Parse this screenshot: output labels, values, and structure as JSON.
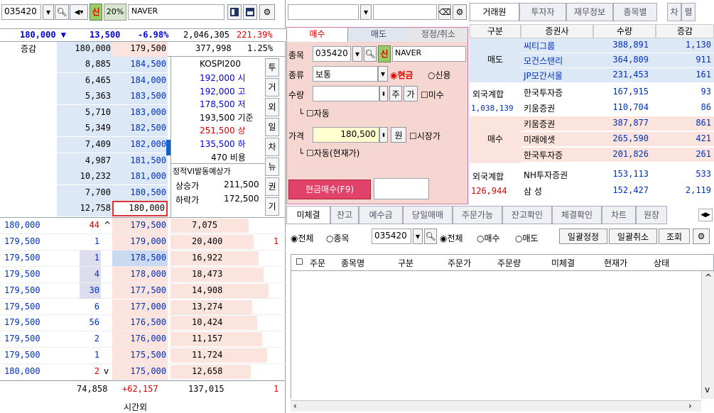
{
  "left": {
    "code": "035420",
    "sin": "신",
    "margin": "20%",
    "name": "NAVER",
    "price": "180,000 ▼",
    "change": "13,500",
    "rate": "-6.98%",
    "volume": "2,046,305",
    "vrate": "221.39%",
    "hdr": {
      "label": "증감",
      "v1": "180,000",
      "v2": "179,500",
      "v3": "377,998",
      "v4": "1.25%"
    },
    "asks": [
      {
        "q": "8,885",
        "p": "184,500"
      },
      {
        "q": "6,465",
        "p": "184,000"
      },
      {
        "q": "5,363",
        "p": "183,500"
      },
      {
        "q": "5,710",
        "p": "183,000"
      },
      {
        "q": "5,349",
        "p": "182,500"
      },
      {
        "q": "7,409",
        "p": "182,000"
      },
      {
        "q": "4,987",
        "p": "181,500"
      },
      {
        "q": "10,232",
        "p": "181,000"
      },
      {
        "q": "7,700",
        "p": "180,500"
      },
      {
        "q": "12,758",
        "p": "180,000"
      }
    ],
    "info": {
      "kospi": "KOSPI200",
      "si": "192,000 시",
      "go": "192,000 고",
      "jeo": "178,500 저",
      "gijun": "193,500 기준",
      "sang": "251,500 상",
      "ha": "135,500 하",
      "biyong": "470 비용",
      "vi": "정적VI발동예상가",
      "sangsung": "상승가",
      "sangsung_v": "211,500",
      "harak": "하락가",
      "harak_v": "172,500"
    },
    "sidebtns": [
      "투",
      "거",
      "외",
      "일",
      "차",
      "뉴",
      "권",
      "기"
    ],
    "bids": [
      {
        "t": "180,000",
        "q": "44",
        "ar": "^",
        "p": "179,500",
        "bq": "7,075",
        "x": ""
      },
      {
        "t": "179,500",
        "q": "1",
        "ar": "",
        "p": "179,000",
        "bq": "20,400",
        "x": "1"
      },
      {
        "t": "179,500",
        "q": "1",
        "ar": "",
        "p": "178,500",
        "bq": "16,922",
        "x": ""
      },
      {
        "t": "179,500",
        "q": "4",
        "ar": "",
        "p": "178,000",
        "bq": "18,473",
        "x": ""
      },
      {
        "t": "179,500",
        "q": "30",
        "ar": "",
        "p": "177,500",
        "bq": "14,908",
        "x": ""
      },
      {
        "t": "179,500",
        "q": "6",
        "ar": "",
        "p": "177,000",
        "bq": "13,274",
        "x": ""
      },
      {
        "t": "179,500",
        "q": "56",
        "ar": "",
        "p": "176,500",
        "bq": "10,424",
        "x": ""
      },
      {
        "t": "179,500",
        "q": "2",
        "ar": "",
        "p": "176,000",
        "bq": "11,157",
        "x": ""
      },
      {
        "t": "179,500",
        "q": "1",
        "ar": "",
        "p": "175,500",
        "bq": "11,724",
        "x": ""
      },
      {
        "t": "180,000",
        "q": "2",
        "ar": "v",
        "p": "175,000",
        "bq": "12,658",
        "x": ""
      }
    ],
    "foot": {
      "a": "74,858",
      "b": "+62,157",
      "c": "137,015",
      "d": "1",
      "e": "시간외"
    }
  },
  "mid": {
    "tabs": [
      "매수",
      "매도",
      "정정/취소"
    ],
    "jongmok": "종목",
    "code": "035420",
    "sin": "신",
    "name": "NAVER",
    "jongryu": "종류",
    "jongryu_v": "보통",
    "cash": "현금",
    "credit": "신용",
    "suryang": "수량",
    "ju": "주",
    "ga": "가",
    "misu": "미수",
    "auto": "자동",
    "gagyeok": "가격",
    "price": "180,500",
    "won": "원",
    "market": "시장가",
    "auto2": "자동(현재가)",
    "submit": "현금매수(F9)"
  },
  "right": {
    "tabs": [
      "거래원",
      "투자자",
      "재무정보",
      "종목별",
      "차",
      "펼"
    ],
    "cols": [
      "구분",
      "증권사",
      "수량",
      "증감"
    ],
    "sell_label": "매도",
    "buy_label": "매수",
    "sell": [
      {
        "f": "씨티그룹",
        "q": "388,891",
        "d": "1,130"
      },
      {
        "f": "모건스탠리",
        "q": "364,809",
        "d": "911"
      },
      {
        "f": "JP모간서울",
        "q": "231,453",
        "d": "161"
      }
    ],
    "sell_ext": {
      "label": "외국계합",
      "f1": "한국투자증",
      "q1": "167,915",
      "d1": "93",
      "total": "1,038,139",
      "f2": "키움증권",
      "q2": "110,704",
      "d2": "86"
    },
    "buy": [
      {
        "f": "키움증권",
        "q": "387,877",
        "d": "861"
      },
      {
        "f": "미래에셋",
        "q": "265,590",
        "d": "421"
      },
      {
        "f": "한국투자증",
        "q": "201,826",
        "d": "261"
      }
    ],
    "buy_ext": {
      "label": "외국계합",
      "f1": "NH투자증권",
      "q1": "153,113",
      "d1": "533",
      "total": "126,944",
      "f2": "삼  성",
      "q2": "152,427",
      "d2": "2,119"
    }
  },
  "bottom": {
    "tabs": [
      "미체결",
      "잔고",
      "예수금",
      "당일매매",
      "주문가능",
      "잔고확인",
      "체결확인",
      "차트",
      "원장"
    ],
    "opts": {
      "all": "전체",
      "jong": "종목",
      "code": "035420",
      "all2": "전체",
      "buy": "매수",
      "sell": "매도",
      "b1": "일괄정정",
      "b2": "일괄취소",
      "b3": "조회"
    },
    "cols": [
      "주문",
      "종목명",
      "구분",
      "주문가",
      "주문량",
      "미체결",
      "현재가",
      "상태"
    ]
  }
}
